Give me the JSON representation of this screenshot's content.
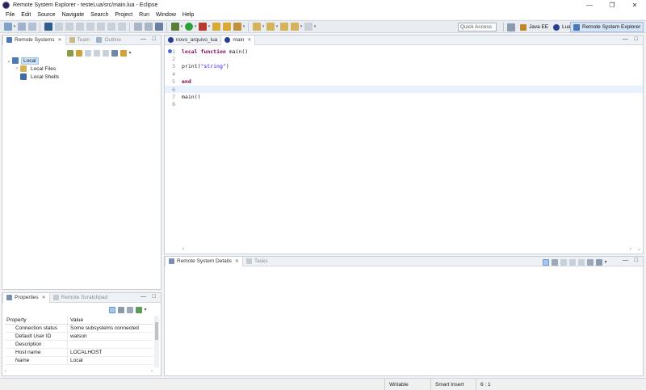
{
  "window": {
    "title": "Remote System Explorer - testeLua/src/main.lua - Eclipse"
  },
  "menu": [
    "File",
    "Edit",
    "Source",
    "Navigate",
    "Search",
    "Project",
    "Run",
    "Window",
    "Help"
  ],
  "toolbar": {
    "quick_access_placeholder": "Quick Access",
    "perspectives": [
      "Java EE",
      "Lua",
      "Remote System Explorer"
    ],
    "accent": "#3a7bd5"
  },
  "left_view": {
    "tabs": [
      "Remote Systems",
      "Team",
      "Outline"
    ],
    "tree": {
      "root": "Local",
      "children": [
        "Local Files",
        "Local Shells"
      ]
    }
  },
  "properties_view": {
    "tabs": [
      "Properties",
      "Remote Scratchpad"
    ],
    "columns": [
      "Property",
      "Value"
    ],
    "rows": [
      {
        "property": "Connection status",
        "value": "Some subsystems connected"
      },
      {
        "property": "Default User ID",
        "value": "watson"
      },
      {
        "property": "Description",
        "value": ""
      },
      {
        "property": "Host name",
        "value": "LOCALHOST"
      },
      {
        "property": "Name",
        "value": "Local"
      }
    ]
  },
  "editor": {
    "tabs": [
      "novo_arquivo_lua",
      "main"
    ],
    "active_tab": "main",
    "line_numbers": [
      "1",
      "2",
      "3",
      "4",
      "5",
      "6",
      "7",
      "8"
    ],
    "code": {
      "l1_kw1": "local",
      "l1_kw2": "function",
      "l1_rest": " main()",
      "l3_a": "print(",
      "l3_str": "\"string\"",
      "l3_b": ")",
      "l5_kw": "end",
      "l7": "main()"
    }
  },
  "bottom_view": {
    "tabs": [
      "Remote System Details",
      "Tasks"
    ]
  },
  "status_bar": {
    "writable": "Writable",
    "insert_mode": "Smart Insert",
    "position": "6 : 1"
  }
}
